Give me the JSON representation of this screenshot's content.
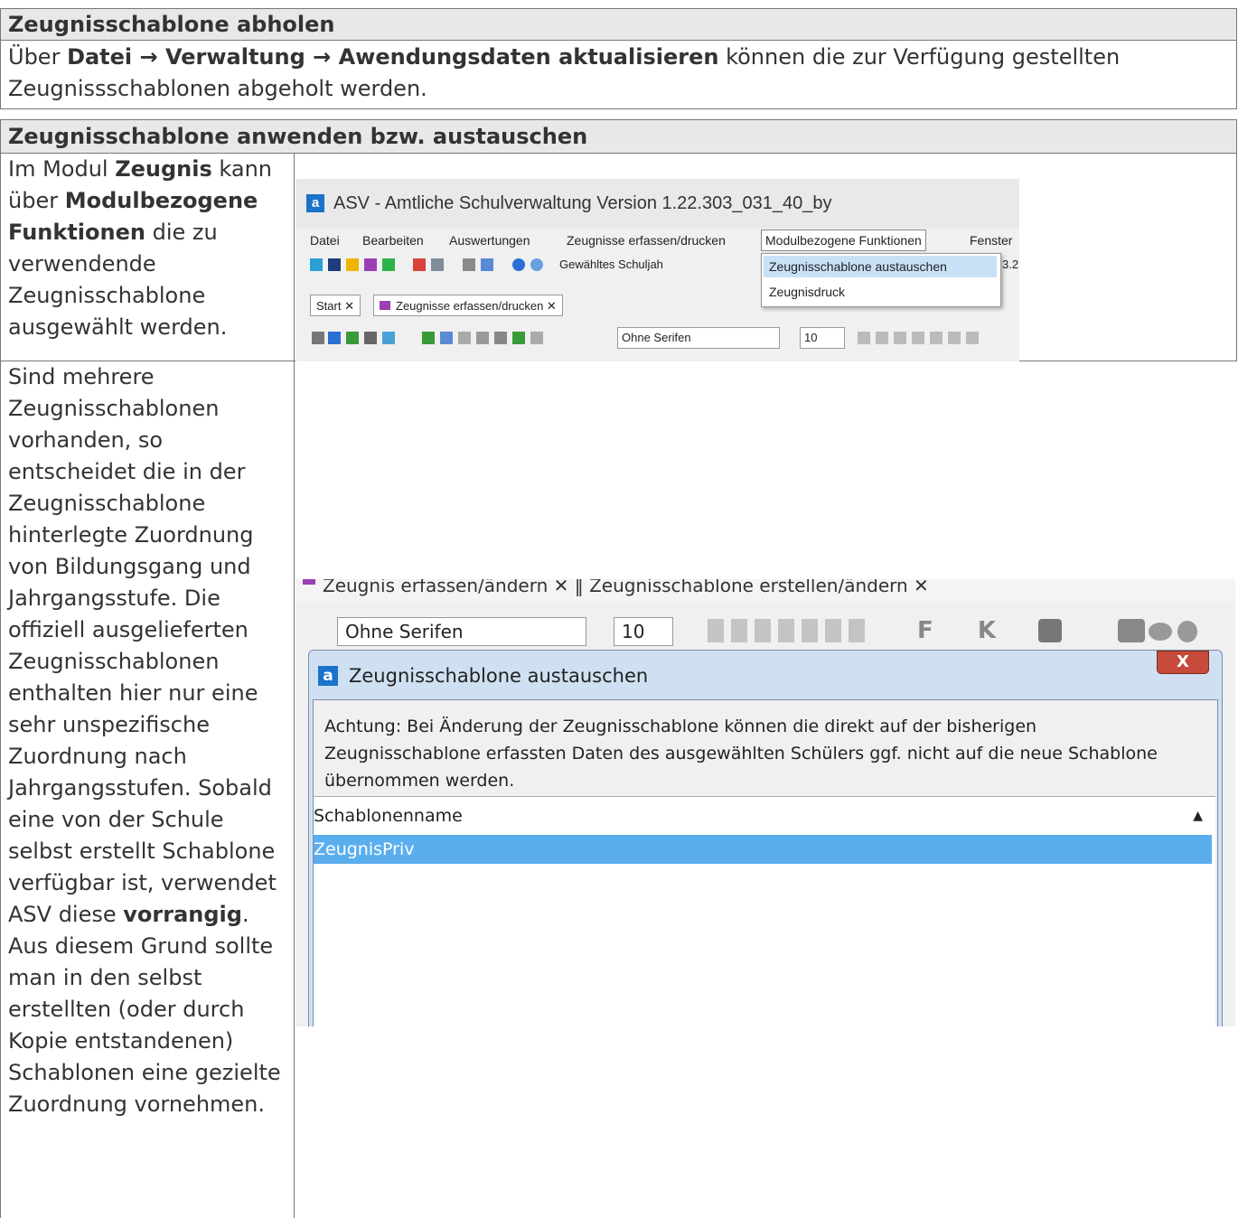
{
  "section1": {
    "heading": "Zeugnisschablone abholen",
    "text_pre": "Über ",
    "text_bold": "Datei → Verwaltung → Awendungsdaten aktualisieren",
    "text_post": " können die zur Verfügung gestellten Zeugnissschablonen abgeholt werden."
  },
  "section2": {
    "heading": "Zeugnisschablone anwenden bzw. austauschen",
    "p1": {
      "a": "Im Modul ",
      "b": "Zeugnis",
      "c": " kann über ",
      "d": "Modulbezogene Funktionen",
      "e": " die zu verwendende Zeugnisschablone ausgewählt werden."
    },
    "p2": {
      "a": "Sind mehrere Zeugnisschablonen vorhanden, so entscheidet die in der Zeugnisschablone hinterlegte Zuordnung von Bildungsgang und Jahrgangsstufe. Die offiziell ausgelieferten Zeugnisschablonen enthalten hier nur eine sehr unspezifische Zuordnung nach Jahrgangsstufen. Sobald eine von der Schule selbst erstellt Schablone verfügbar ist, verwendet ASV diese ",
      "b": "vorrangig",
      "c": ". Aus diesem Grund sollte man in den selbst erstellten (oder durch Kopie entstandenen) Schablonen eine gezielte Zuordnung vornehmen."
    }
  },
  "screenshot1": {
    "window_title": "ASV - Amtliche Schulverwaltung Version 1.22.303_031_40_by",
    "logo": "a",
    "menu": [
      "Datei",
      "Bearbeiten",
      "Auswertungen",
      "Zeugnisse erfassen/drucken",
      "Modulbezogene Funktionen",
      "Fenster"
    ],
    "toolbar_label": "Gewähltes Schuljah",
    "toolbar_value_fragment": "3.2",
    "dropdown": [
      "Zeugnisschablone austauschen",
      "Zeugnisdruck"
    ],
    "tabs": [
      "Start",
      "Zeugnisse erfassen/drucken"
    ],
    "font": "Ohne Serifen",
    "size": "10"
  },
  "screenshot2": {
    "tabs_fragment": "Zeugnis erfassen/ändern ✕ ‖ Zeugnisschablone erstellen/ändern ✕",
    "font": "Ohne Serifen",
    "size": "10",
    "format_letters": "F K U",
    "dialog_title": "Zeugnisschablone austauschen",
    "close": "X",
    "message": "Achtung: Bei Änderung der Zeugnisschablone können die direkt auf der bisherigen Zeugnisschablone erfassten Daten des ausgewählten Schülers ggf. nicht auf die neue Schablone übernommen werden.",
    "column": "Schablonenname",
    "row": "ZeugnisPriv"
  }
}
